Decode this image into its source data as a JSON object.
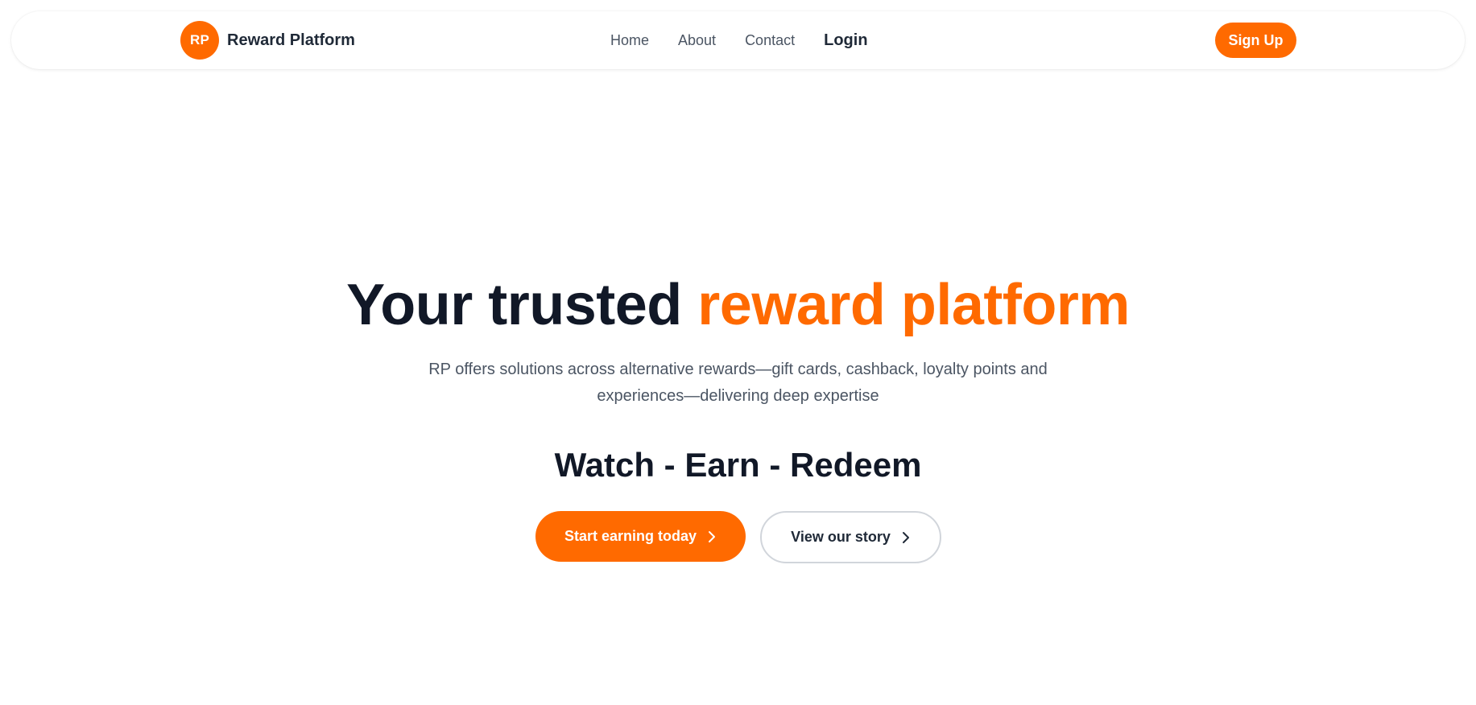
{
  "brand": {
    "badge": "RP",
    "name": "Reward Platform"
  },
  "nav": {
    "home": "Home",
    "about": "About",
    "contact": "Contact",
    "login": "Login"
  },
  "header": {
    "signup_label": "Sign Up"
  },
  "hero": {
    "title_plain": "Your trusted ",
    "title_accent": "reward platform",
    "subtitle": "RP offers solutions across alternative rewards—gift cards, cashback, loyalty points and experiences—delivering deep expertise",
    "tagline": "Watch - Earn - Redeem",
    "primary_cta": "Start earning today",
    "secondary_cta": "View our story"
  },
  "icons": {
    "primary_cta_icon": "chevron-right-icon",
    "secondary_cta_icon": "chevron-right-icon"
  },
  "colors": {
    "accent": "#ff6a00",
    "text_dark": "#111827",
    "text_muted": "#4b5563"
  }
}
